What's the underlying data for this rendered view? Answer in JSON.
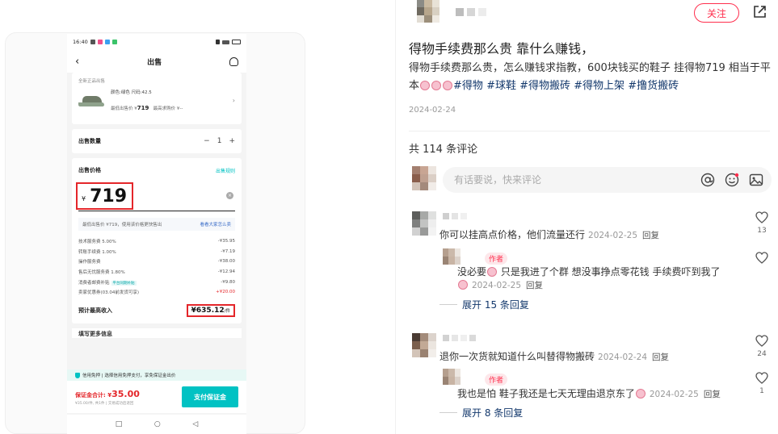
{
  "phone": {
    "status_time": "16:40",
    "header_title": "出售",
    "product_label": "全新正品出售",
    "product_spec": "颜色:绿色 尺码:42.5",
    "lowest_price_label": "最低出售价 ¥",
    "lowest_price": "719",
    "lowest_buy_label": "最高求购价 ¥--",
    "qty_label": "出售数量",
    "qty_value": "1",
    "price_label": "出售价格",
    "price_rule": "出售规则",
    "currency": "¥",
    "price_value": "719",
    "hint_text": "最低出售价 ¥719，使用该价格更快售出",
    "hint_link": "看看大家怎么卖",
    "fees": [
      {
        "label": "技术服务费 5.00%",
        "value": "-¥35.95",
        "red": false
      },
      {
        "label": "转账手续费 1.00%",
        "value": "-¥7.19",
        "red": false
      },
      {
        "label": "操作服务费",
        "value": "-¥38.00",
        "red": false
      },
      {
        "label": "售后无忧服务费 1.80%",
        "value": "-¥12.94",
        "red": false
      },
      {
        "label": "消费者邮费补贴",
        "value": "-¥9.80",
        "red": false,
        "tag": "平台同期补贴"
      },
      {
        "label": "卖家优惠券(03.04前发货可享)",
        "value": "+¥20.00",
        "red": true
      }
    ],
    "income_label": "预计最高收入",
    "income_value": "¥635.12",
    "income_unit": "/件",
    "more_title": "填写更多信息",
    "credit_text": "信用免押 | 选择信用免押支付，享免保证金出价",
    "deposit_label": "保证金合计: ¥",
    "deposit_value": "35.00",
    "deposit_note": "¥35.00/件, 共1件 | 交易成功后退回",
    "pay_button": "支付保证金",
    "nav_square": "□",
    "nav_circle": "○",
    "nav_back": "◁"
  },
  "note": {
    "follow_label": "关注",
    "title": "得物手续费那么贵 靠什么赚钱，",
    "desc_text": "得物手续费那么贵，怎么赚钱求指教，600块钱买的鞋子 挂得物719 相当于平本",
    "tags": [
      "#得物",
      "#球鞋",
      "#得物搬砖",
      "#得物上架",
      "#撸货搬砖"
    ],
    "date": "2024-02-24",
    "comment_count": "共 114 条评论",
    "input_placeholder": "有话要说，快来评论"
  },
  "comments": [
    {
      "text": "你可以挂高点价格，他们流量还行",
      "date": "2024-02-25",
      "reply": "回复",
      "likes": "13",
      "sub": {
        "tag": "作者",
        "text": "没必要",
        "text2": " 只是我进了个群 想没事挣点零花钱  手续费吓到我了",
        "date": "2024-02-25",
        "reply": "回复"
      },
      "expand": "展开 15 条回复"
    },
    {
      "text": "退你一次货就知道什么叫替得物搬砖",
      "date": "2024-02-24",
      "reply": "回复",
      "likes": "24",
      "sub": {
        "tag": "作者",
        "text": "我也是怕  鞋子我还是七天无理由退京东了",
        "date": "2024-02-25",
        "reply": "回复",
        "likes": "1"
      },
      "expand": "展开 8 条回复"
    }
  ],
  "colors": {
    "accent": "#ff2e4d",
    "teal": "#01c2c3",
    "highlight_box": "#e4262a",
    "tag_blue": "#13386c"
  }
}
